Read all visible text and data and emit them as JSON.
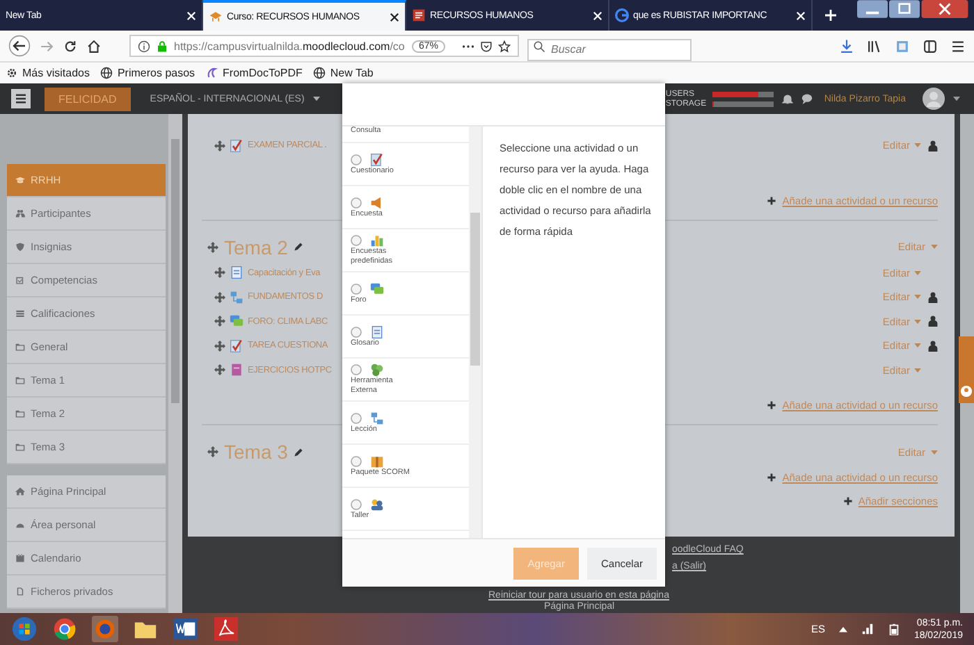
{
  "browser": {
    "tabs": [
      {
        "label": "New Tab",
        "kind": "none",
        "selected": false
      },
      {
        "label": "Curso: RECURSOS HUMANOS",
        "kind": "moodle",
        "selected": true
      },
      {
        "label": "RECURSOS HUMANOS",
        "kind": "doc",
        "selected": false
      },
      {
        "label": "que es RUBISTAR IMPORTANC",
        "kind": "google",
        "selected": false
      }
    ],
    "url": "https://campusvirtualnilda.**moodlecloud.com**/co",
    "zoom": "67%",
    "search": {
      "placeholder": "Buscar"
    },
    "bookmarks": [
      {
        "label": "Más visitados",
        "kind": "gear"
      },
      {
        "label": "Primeros pasos",
        "kind": "globe"
      },
      {
        "label": "FromDocToPDF",
        "kind": "pdf"
      },
      {
        "label": "New Tab",
        "kind": "globe"
      }
    ]
  },
  "moodle_navbar": {
    "brand": "FELICIDAD",
    "language": "ESPAÑOL - INTERNACIONAL (ES)",
    "meters": [
      {
        "label": "USERS",
        "level": 0.75
      },
      {
        "label": "STORAGE",
        "level": 0.02
      }
    ],
    "user_name": "Nilda Pizarro Tapia"
  },
  "sidebar": {
    "items": [
      {
        "label": "RRHH",
        "kind": "cap",
        "selected": true
      },
      {
        "label": "Participantes",
        "kind": "people",
        "selected": false
      },
      {
        "label": "Insignias",
        "kind": "shield",
        "selected": false
      },
      {
        "label": "Competencias",
        "kind": "checkbox",
        "selected": false
      },
      {
        "label": "Calificaciones",
        "kind": "list",
        "selected": false
      },
      {
        "label": "General",
        "kind": "folder",
        "selected": false
      },
      {
        "label": "Tema 1",
        "kind": "folder",
        "selected": false
      },
      {
        "label": "Tema 2",
        "kind": "folder",
        "selected": false
      },
      {
        "label": "Tema 3",
        "kind": "folder",
        "selected": false
      }
    ],
    "secondary": [
      {
        "label": "Página Principal",
        "kind": "house",
        "selected": false
      },
      {
        "label": "Área personal",
        "kind": "gauge",
        "selected": false
      },
      {
        "label": "Calendario",
        "kind": "calendar",
        "selected": false
      },
      {
        "label": "Ficheros privados",
        "kind": "file",
        "selected": false
      }
    ]
  },
  "course": {
    "sections": [
      {
        "activities": [
          {
            "name": "EXAMEN PARCIAL .",
            "kind": "quiz",
            "edit": "Editar",
            "user_icon": true
          }
        ],
        "add_link": "Añade una actividad o un recurso"
      },
      {
        "title": "Tema 2",
        "edit": "Editar",
        "activities": [
          {
            "name": "Capacitación y Eva",
            "kind": "page",
            "edit": "Editar",
            "user_icon": false
          },
          {
            "name": "FUNDAMENTOS D",
            "kind": "lesson",
            "edit": "Editar",
            "user_icon": true
          },
          {
            "name": "FORO: CLIMA LABC",
            "kind": "forum",
            "edit": "Editar",
            "user_icon": true
          },
          {
            "name": "TAREA CUESTIONA",
            "kind": "quiz",
            "edit": "Editar",
            "user_icon": true
          },
          {
            "name": "EJERCICIOS HOTPC",
            "kind": "hotpot",
            "edit": "Editar",
            "user_icon": false
          }
        ],
        "add_link": "Añade una actividad o un recurso"
      },
      {
        "title": "Tema 3",
        "edit": "Editar",
        "add_link": "Añade una actividad o un recurso"
      }
    ],
    "add_sections": "Añadir secciones"
  },
  "modal": {
    "items": [
      {
        "label": "Consulta",
        "kind": "cut"
      },
      {
        "label": "Cuestionario",
        "kind": "quiz",
        "selected": false
      },
      {
        "label": "Encuesta",
        "kind": "survey",
        "selected": false
      },
      {
        "label": "Encuestas predefinidas",
        "kind": "feedback",
        "selected": false
      },
      {
        "label": "Foro",
        "kind": "forum",
        "selected": false
      },
      {
        "label": "Glosario",
        "kind": "glossary",
        "selected": false
      },
      {
        "label": "Herramienta Externa",
        "kind": "lti",
        "selected": false
      },
      {
        "label": "Lección",
        "kind": "lesson",
        "selected": false
      },
      {
        "label": "Paquete SCORM",
        "kind": "scorm",
        "selected": false
      },
      {
        "label": "Taller",
        "kind": "workshop",
        "selected": false
      }
    ],
    "help": "Seleccione una actividad o un recurso para ver la ayuda. Haga doble clic en el nombre de una actividad o recurso para añadirla de forma rápida",
    "buttons": [
      {
        "label": "Agregar",
        "kind": "primary",
        "disabled": true
      },
      {
        "label": "Cancelar",
        "kind": "secondary",
        "disabled": false
      }
    ]
  },
  "footer": {
    "faq": "oodleCloud FAQ",
    "logout": "a (Salir)",
    "tour": "Reiniciar tour para usuario en esta página",
    "home": "Página Principal"
  },
  "taskbar": {
    "apps": [
      {
        "kind": "start"
      },
      {
        "kind": "chrome"
      },
      {
        "kind": "firefox"
      },
      {
        "kind": "folder"
      },
      {
        "kind": "word"
      },
      {
        "kind": "acrobat"
      }
    ],
    "language": "ES",
    "time": "08:51 p.m.",
    "date": "18/02/2019"
  }
}
